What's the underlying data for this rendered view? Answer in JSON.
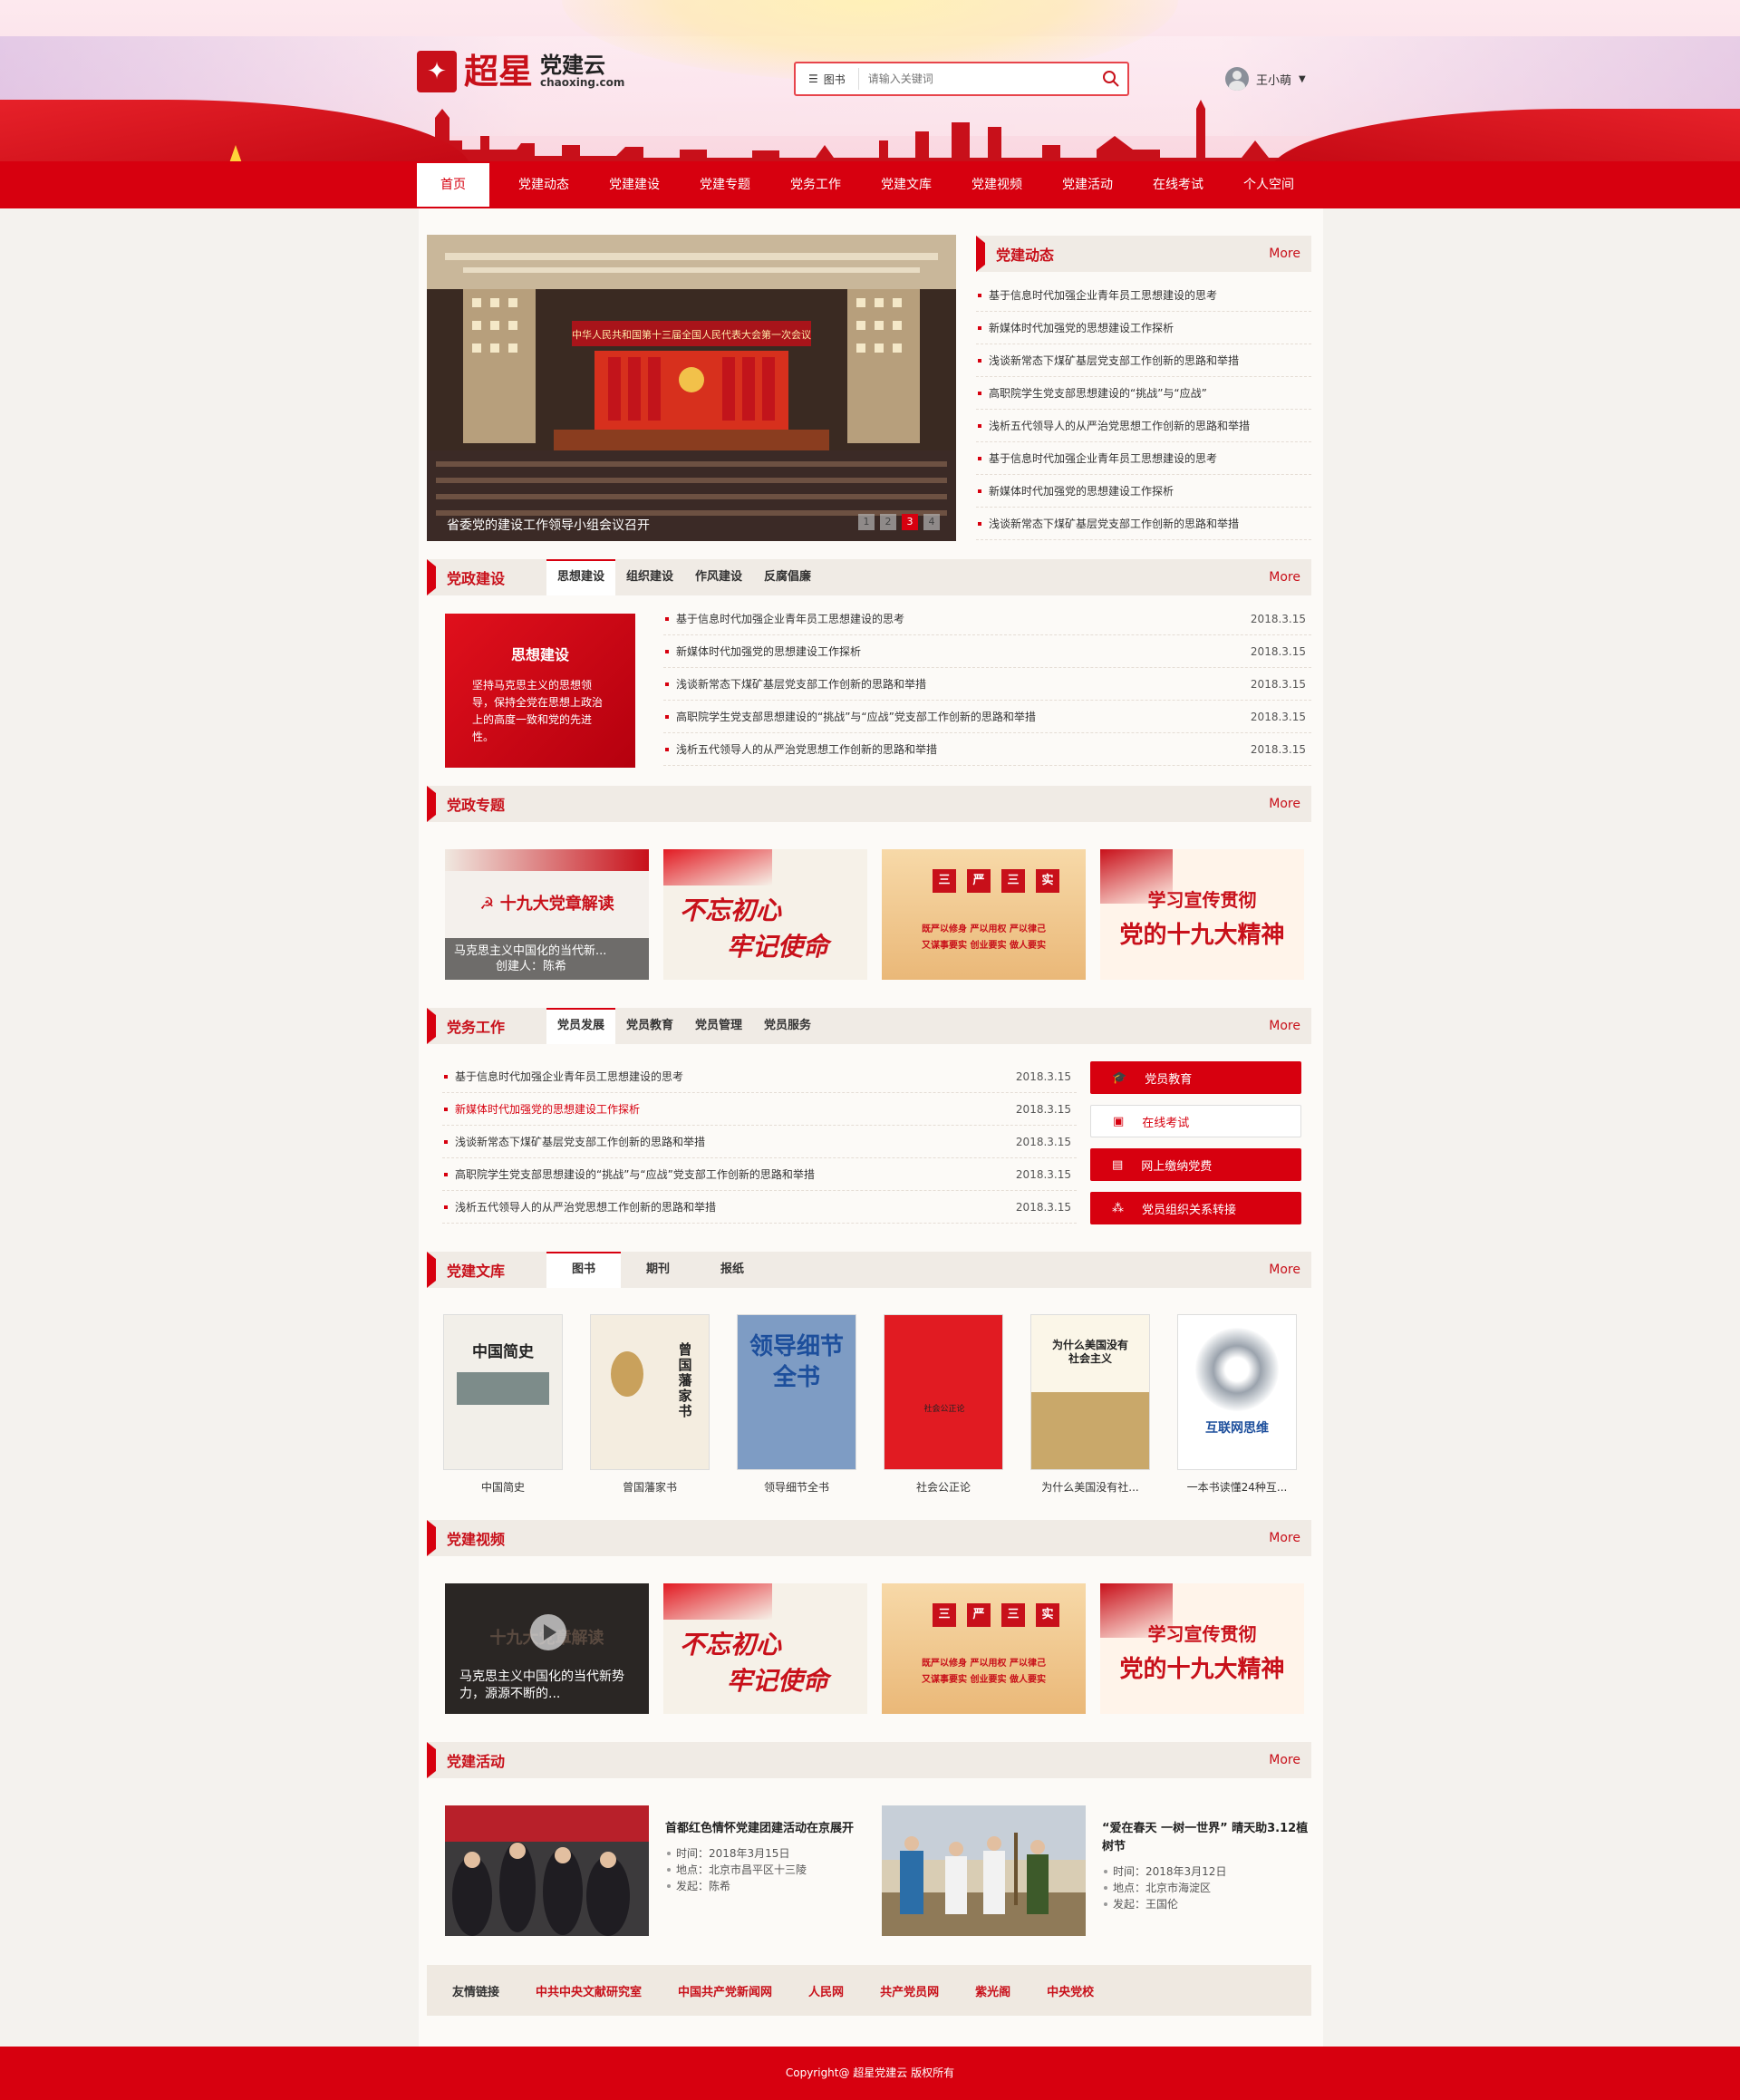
{
  "header": {
    "brand": "超星",
    "product": "党建云",
    "url": "chaoxing.com",
    "search": {
      "category": "图书",
      "placeholder": "请输入关键词"
    },
    "user": "王小萌"
  },
  "nav": [
    "首页",
    "党建动态",
    "党建建设",
    "党建专题",
    "党务工作",
    "党建文库",
    "党建视频",
    "党建活动",
    "在线考试",
    "个人空间"
  ],
  "slider": {
    "caption": "省委党的建设工作领导小组会议召开",
    "banner": "中华人民共和国第十三届全国人民代表大会第一次会议",
    "pages": [
      "1",
      "2",
      "3",
      "4"
    ],
    "active": 3
  },
  "dynamics": {
    "title": "党建动态",
    "more": "More",
    "items": [
      "基于信息时代加强企业青年员工思想建设的思考",
      "新媒体时代加强党的思想建设工作探析",
      "浅谈新常态下煤矿基层党支部工作创新的思路和举措",
      "高职院学生党支部思想建设的“挑战”与“应战”",
      "浅析五代领导人的从严治党思想工作创新的思路和举措",
      "基于信息时代加强企业青年员工思想建设的思考",
      "新媒体时代加强党的思想建设工作探析",
      "浅谈新常态下煤矿基层党支部工作创新的思路和举措"
    ]
  },
  "building": {
    "title": "党政建设",
    "more": "More",
    "tabs": [
      "思想建设",
      "组织建设",
      "作风建设",
      "反腐倡廉"
    ],
    "card": {
      "head": "思想建设",
      "text": "坚持马克思主义的思想领导，保持全党在思想上政治上的高度一致和党的先进性。"
    },
    "items": [
      {
        "t": "基于信息时代加强企业青年员工思想建设的思考",
        "d": "2018.3.15"
      },
      {
        "t": "新媒体时代加强党的思想建设工作探析",
        "d": "2018.3.15"
      },
      {
        "t": "浅谈新常态下煤矿基层党支部工作创新的思路和举措",
        "d": "2018.3.15"
      },
      {
        "t": "高职院学生党支部思想建设的“挑战”与“应战”党支部工作创新的思路和举措",
        "d": "2018.3.15"
      },
      {
        "t": "浅析五代领导人的从严治党思想工作创新的思路和举措",
        "d": "2018.3.15"
      }
    ]
  },
  "topics": {
    "title": "党政专题",
    "more": "More",
    "t1": {
      "title": "十九大党章解读",
      "cap1": "马克思主义中国化的当代新...",
      "cap2": "创建人：陈希"
    },
    "t2": {
      "l1": "不忘初心",
      "l2": "牢记使命"
    },
    "t3": {
      "c1": "三",
      "c2": "严",
      "c3": "三",
      "c4": "实",
      "r1": "既严以修身  严以用权  严以律己",
      "r2": "又谋事要实  创业要实  做人要实"
    },
    "t4": {
      "l1": "学习宣传贯彻",
      "l2": "党的十九大精神"
    }
  },
  "affairs": {
    "title": "党务工作",
    "more": "More",
    "tabs": [
      "党员发展",
      "党员教育",
      "党员管理",
      "党员服务"
    ],
    "items": [
      {
        "t": "基于信息时代加强企业青年员工思想建设的思考",
        "d": "2018.3.15"
      },
      {
        "t": "新媒体时代加强党的思想建设工作探析",
        "d": "2018.3.15"
      },
      {
        "t": "浅谈新常态下煤矿基层党支部工作创新的思路和举措",
        "d": "2018.3.15"
      },
      {
        "t": "高职院学生党支部思想建设的“挑战”与“应战”党支部工作创新的思路和举措",
        "d": "2018.3.15"
      },
      {
        "t": "浅析五代领导人的从严治党思想工作创新的思路和举措",
        "d": "2018.3.15"
      }
    ],
    "buttons": [
      "党员教育",
      "在线考试",
      "网上缴纳党费",
      "党员组织关系转接"
    ]
  },
  "library": {
    "title": "党建文库",
    "more": "More",
    "tabs": [
      "图书",
      "期刊",
      "报纸"
    ],
    "books": [
      {
        "label": "中国简史",
        "cover": "中国简史"
      },
      {
        "label": "曾国藩家书",
        "cover": "曾国藩家书"
      },
      {
        "label": "领导细节全书",
        "cover": "领导细节全书"
      },
      {
        "label": "社会公正论",
        "cover": "社会公正论"
      },
      {
        "label": "为什么美国没有社...",
        "cover": "为什么美国没有社会主义"
      },
      {
        "label": "一本书读懂24种互...",
        "cover": "互联网思维"
      }
    ]
  },
  "videos": {
    "title": "党建视频",
    "more": "More",
    "v1": {
      "bg": "十九大党章解读",
      "cap": "马克思主义中国化的当代新势力，源源不断的..."
    }
  },
  "activities": {
    "title": "党建活动",
    "more": "More",
    "items": [
      {
        "title": "首都红色情怀党建团建活动在京展开",
        "time": "时间：2018年3月15日",
        "place": "地点：北京市昌平区十三陵",
        "by": "发起：陈希"
      },
      {
        "title": "“爱在春天 一树一世界” 晴天助3.12植树节",
        "time": "时间：2018年3月12日",
        "place": "地点：北京市海淀区",
        "by": "发起：王国伦"
      }
    ]
  },
  "links": {
    "label": "友情链接",
    "items": [
      "中共中央文献研究室",
      "中国共产党新闻网",
      "人民网",
      "共产党员网",
      "紫光阁",
      "中央党校"
    ]
  },
  "footer": "Copyright@ 超星党建云  版权所有"
}
